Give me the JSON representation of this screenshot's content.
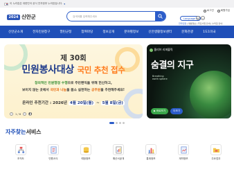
{
  "gov_banner": {
    "text": "이 누리집은 대한민국 공식 전자정부 누리집입니다."
  },
  "header": {
    "logo_mark": "2024",
    "logo_text": "신안군",
    "search": {
      "placeholder": "검색어를 입력해주세요"
    },
    "util_links": [
      "로그인",
      "회원가입"
    ],
    "language": "Language ▾",
    "zoom": [
      "+",
      "−"
    ],
    "quick_links": [
      "전자민원",
      "생활정보",
      "주요사업 안내",
      "누리집 안내"
    ]
  },
  "nav": [
    "신안군소개",
    "전자민원창구",
    "열린군정",
    "참여마당",
    "정보공개",
    "분야별정보",
    "신안생활정보센터",
    "문화관광",
    "1도1미국"
  ],
  "hero_left": {
    "title": "제 30회",
    "main": "민원봉사대상",
    "accent": "국민 추천 접수",
    "desc1_g": "창의적인 민원행정 수행",
    "desc1_rest": "으로 주민편익을 위해 헌신하고,",
    "desc2_pre": "보이지 않는 곳에서 ",
    "desc2_o1": "국민과 나눔",
    "desc2_mid": "을 몸소 실천하는 ",
    "desc2_o2": "공무원",
    "desc2_end": "을 추천해주세요!",
    "date_prefix": "온라인 추천기간 : 2026년 ",
    "date_start": "4월 20일(월)",
    "date_sep": " ~ ",
    "date_end": "5월 8일(금)",
    "counter": "1 / 6",
    "pause": "❚❚"
  },
  "hero_right": {
    "brand": "올리브 리퍼블릭",
    "title": "숨결의 지구",
    "sub1": "Breathing",
    "sub2": "earth sphere",
    "btn_1": "▶ 바로보기",
    "btn_2": "더보기"
  },
  "services": {
    "title_accent": "자주찾는",
    "title_rest": "서비스",
    "items": [
      {
        "label": "조직도",
        "icon": "org-chart-icon"
      },
      {
        "label": "민원서식",
        "icon": "form-document-icon"
      },
      {
        "label": "예정정보",
        "icon": "schedule-coin-icon"
      },
      {
        "label": "예산서공개",
        "icon": "budget-report-icon"
      },
      {
        "label": "통계정보",
        "icon": "statistics-icon"
      },
      {
        "label": "계약정보",
        "icon": "contract-icon"
      },
      {
        "label": "주요업무",
        "icon": "task-folder-icon"
      }
    ]
  },
  "colors": {
    "primary": "#1f4fb8",
    "accent_orange": "#ff7a1a",
    "hero_green": "#3aa64a"
  }
}
